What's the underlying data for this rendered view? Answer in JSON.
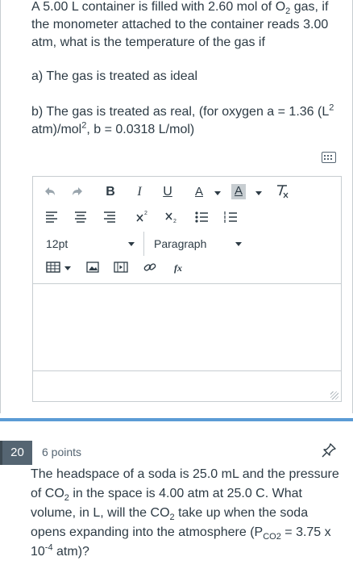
{
  "q19": {
    "text_a": "A 5.00 L container is filled with 2.60 mol of O",
    "text_sub": "2",
    "text_b": " gas, if the monometer attached to the container reads 3.00 atm, what is the temperature of the gas if",
    "part_a": "a) The gas is treated as ideal",
    "part_b_1": "b) The gas is treated as real, (for oxygen a = 1.36 (L",
    "part_b_sup1": "2",
    "part_b_2": " atm)/mol",
    "part_b_sup2": "2",
    "part_b_3": ", b = 0.0318 L/mol)"
  },
  "editor": {
    "toolbar": {
      "bold": "B",
      "italic": "I",
      "underline": "U",
      "font_color": "A",
      "bg_color": "A",
      "font_size": "12pt",
      "block_format": "Paragraph",
      "formula": "fx"
    },
    "icons": [
      "undo-icon",
      "redo-icon",
      "clear-format-icon",
      "align-left-icon",
      "align-center-icon",
      "align-right-icon",
      "superscript-icon",
      "subscript-icon",
      "bullet-list-icon",
      "numbered-list-icon",
      "table-icon",
      "image-icon",
      "media-icon",
      "link-icon",
      "formula-icon",
      "keyboard-icon",
      "resize-grip-icon"
    ]
  },
  "q20": {
    "number": "20",
    "points": "6 points",
    "t1": "The headspace of a soda is 25.0 mL and the pressure of CO",
    "t1_sub": "2",
    "t2": " in the space is 4.00 atm at 25.0 C. What volume, in L, will the CO",
    "t2_sub": "2",
    "t3": " take up when the soda opens expanding into the atmosphere (P",
    "t3_sub": "CO2",
    "t4": " = 3.75 x 10",
    "t4_sup": "-4",
    "t5": " atm)?"
  },
  "colors": {
    "text": "#2d3b45",
    "divider": "#5b9bd5",
    "badge": "#556572",
    "border": "#c7cdd1"
  }
}
